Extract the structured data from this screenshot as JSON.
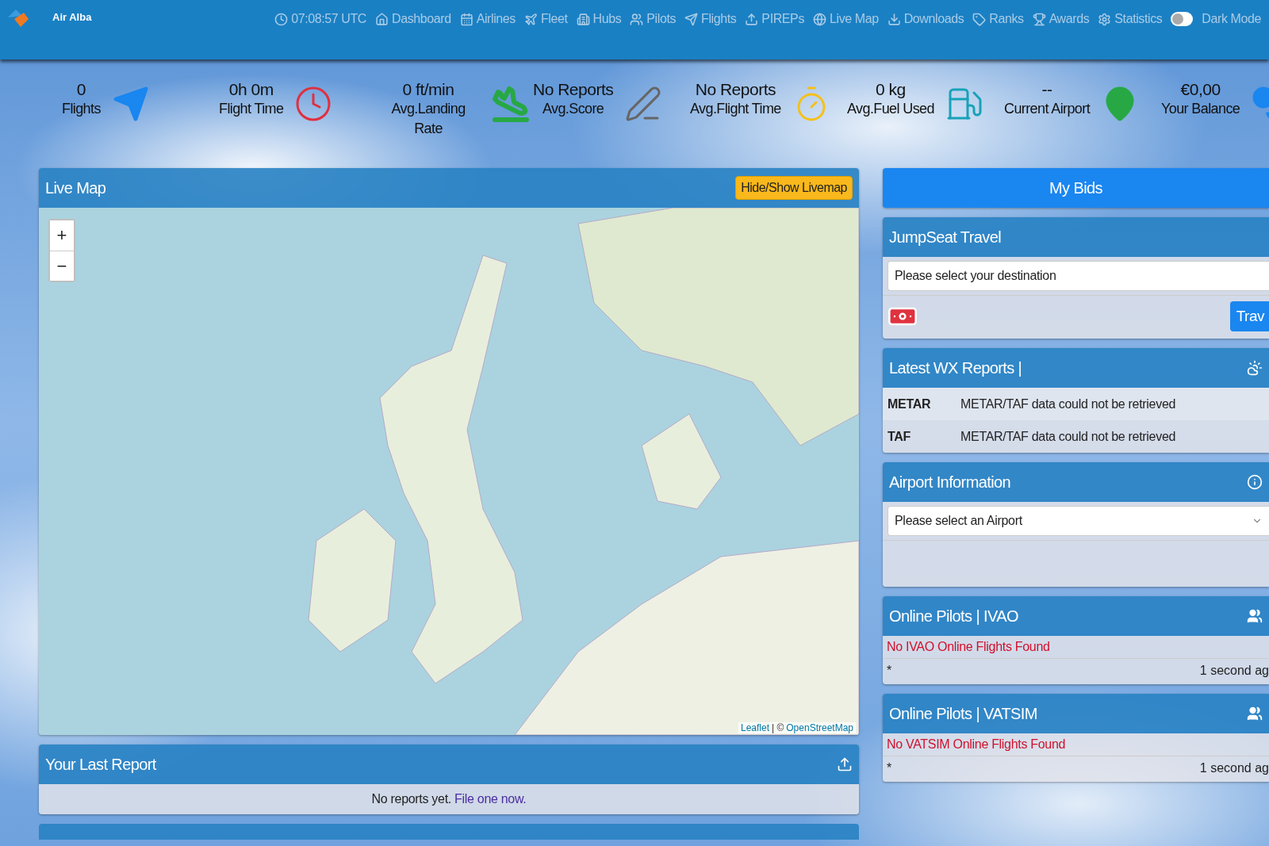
{
  "brand": {
    "name": "Air Alba"
  },
  "nav": [
    {
      "kind": "clock",
      "label": "07:08:57 UTC"
    },
    {
      "kind": "home",
      "label": "Dashboard"
    },
    {
      "kind": "calendar",
      "label": "Airlines"
    },
    {
      "kind": "plane",
      "label": "Fleet"
    },
    {
      "kind": "building",
      "label": "Hubs"
    },
    {
      "kind": "users",
      "label": "Pilots"
    },
    {
      "kind": "send",
      "label": "Flights"
    },
    {
      "kind": "upload",
      "label": "PIREPs"
    },
    {
      "kind": "globe",
      "label": "Live Map"
    },
    {
      "kind": "download",
      "label": "Downloads"
    },
    {
      "kind": "tag",
      "label": "Ranks"
    },
    {
      "kind": "trophy",
      "label": "Awards"
    },
    {
      "kind": "gear",
      "label": "Statistics"
    }
  ],
  "dark_mode": {
    "label": "Dark Mode",
    "on": false
  },
  "stats": [
    {
      "kind": "flights",
      "value": "0",
      "label": "Flights"
    },
    {
      "kind": "time",
      "value": "0h 0m",
      "label": "Flight Time"
    },
    {
      "kind": "landing",
      "value": "0 ft/min",
      "label": "Avg.Landing Rate"
    },
    {
      "kind": "score",
      "value": "No Reports",
      "label": "Avg.Score"
    },
    {
      "kind": "duration",
      "value": "No Reports",
      "label": "Avg.Flight Time"
    },
    {
      "kind": "fuel",
      "value": "0 kg",
      "label": "Avg.Fuel Used"
    },
    {
      "kind": "airport",
      "value": "--",
      "label": "Current Airport"
    },
    {
      "kind": "balance",
      "value": "€0,00",
      "label": "Your Balance"
    }
  ],
  "live_map": {
    "title": "Live Map",
    "toggle_button": "Hide/Show Livemap",
    "zoom_in": "+",
    "zoom_out": "−",
    "attribution": {
      "leaflet": "Leaflet",
      "separator": "| ©",
      "osm": "OpenStreetMap"
    }
  },
  "last_report": {
    "title": "Your Last Report",
    "message": "No reports yet.",
    "link": "File one now."
  },
  "my_bids": {
    "label": "My Bids"
  },
  "jumpseat": {
    "title": "JumpSeat Travel",
    "placeholder": "Please select your destination",
    "button": "Trav"
  },
  "wx": {
    "title": "Latest WX Reports |",
    "rows": [
      {
        "type": "METAR",
        "text": "METAR/TAF data could not be retrieved"
      },
      {
        "type": "TAF",
        "text": "METAR/TAF data could not be retrieved"
      }
    ]
  },
  "airport_info": {
    "title": "Airport Information",
    "placeholder": "Please select an Airport"
  },
  "online": [
    {
      "title": "Online Pilots | IVAO",
      "message": "No IVAO Online Flights Found",
      "mark": "*",
      "time": "1 second ag"
    },
    {
      "title": "Online Pilots | VATSIM",
      "message": "No VATSIM Online Flights Found",
      "mark": "*",
      "time": "1 second ag"
    }
  ]
}
